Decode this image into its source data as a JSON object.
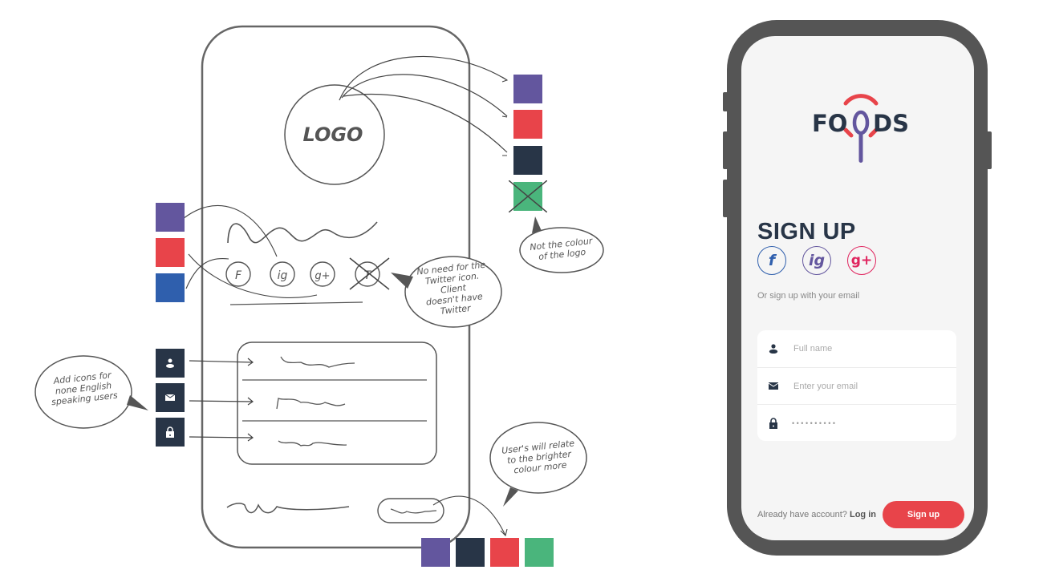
{
  "palette": {
    "purple": "#63569e",
    "red": "#e8444a",
    "navy": "#283547",
    "green": "#4ab57c",
    "blue": "#2f5fad",
    "phone_frame": "#555555",
    "screen_bg": "#f5f5f5"
  },
  "sketch": {
    "logo_label": "LOGO",
    "social_labels": [
      "F",
      "ig",
      "g+",
      "T"
    ],
    "annotations": {
      "twitter": [
        "No need for the",
        "Twitter icon.",
        "Client",
        "doesn't have",
        "Twitter"
      ],
      "logo_colour": [
        "Not the colour",
        "of the logo"
      ],
      "icons": [
        "Add icons for",
        "none English",
        "speaking users"
      ],
      "brighter": [
        "User's will relate",
        "to the brighter",
        "colour more"
      ]
    },
    "icon_tiles": [
      "user-icon",
      "mail-icon",
      "lock-icon"
    ]
  },
  "app": {
    "brand": {
      "left": "FO",
      "right": "DS"
    },
    "title": "SIGN UP",
    "social": [
      {
        "label": "f",
        "name": "facebook",
        "color": "#2f5fad"
      },
      {
        "label": "ig",
        "name": "instagram",
        "color": "#63569e"
      },
      {
        "label": "g+",
        "name": "google-plus",
        "color": "#e0245e"
      }
    ],
    "or_text": "Or sign up with your email",
    "form": {
      "full_name_placeholder": "Full name",
      "email_placeholder": "Enter your email",
      "password_mask": "••••••••••"
    },
    "footer": {
      "prompt": "Already have account?",
      "login": "Log in",
      "signup_button": "Sign up"
    }
  }
}
